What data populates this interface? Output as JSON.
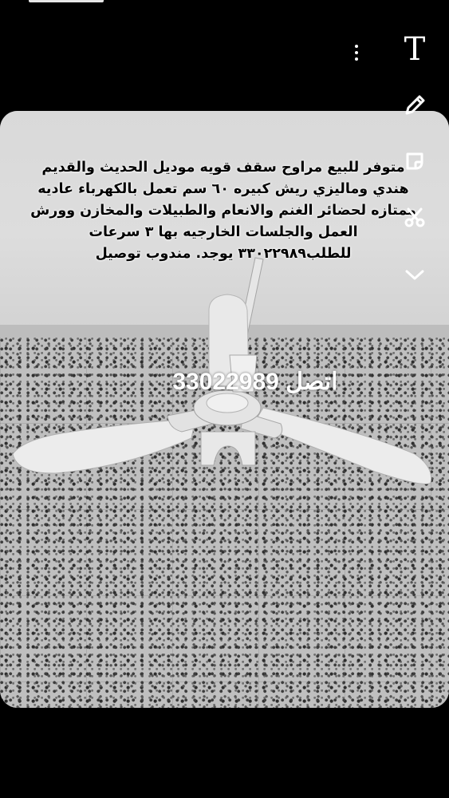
{
  "caption": {
    "line1": "متوفر  للبيع مراوح سقف قويه موديل الحديث والقديم",
    "line2": "هندي وماليزي ريش كبيره ٦٠ سم  تعمل بالكهرباء عاديه",
    "line3": "ممتازه لحضائر الغنم والانعام والطبيلات والمخازن وورش",
    "line4": "العمل والجلسات الخارجيه بها ٣ سرعات",
    "line5": "للطلب٣٣٠٢٢٩٨٩ يوجد.  مندوب توصيل"
  },
  "contact": {
    "text": "اتصل 33022989"
  },
  "toolbar": {
    "text_tool": "T",
    "icons": [
      "more-options-icon",
      "text-icon",
      "pencil-icon",
      "sticker-icon",
      "scissors-icon",
      "chevron-down-icon"
    ]
  },
  "colors": {
    "background": "#000000",
    "caption_text": "#000000",
    "contact_text": "#ffffff"
  }
}
